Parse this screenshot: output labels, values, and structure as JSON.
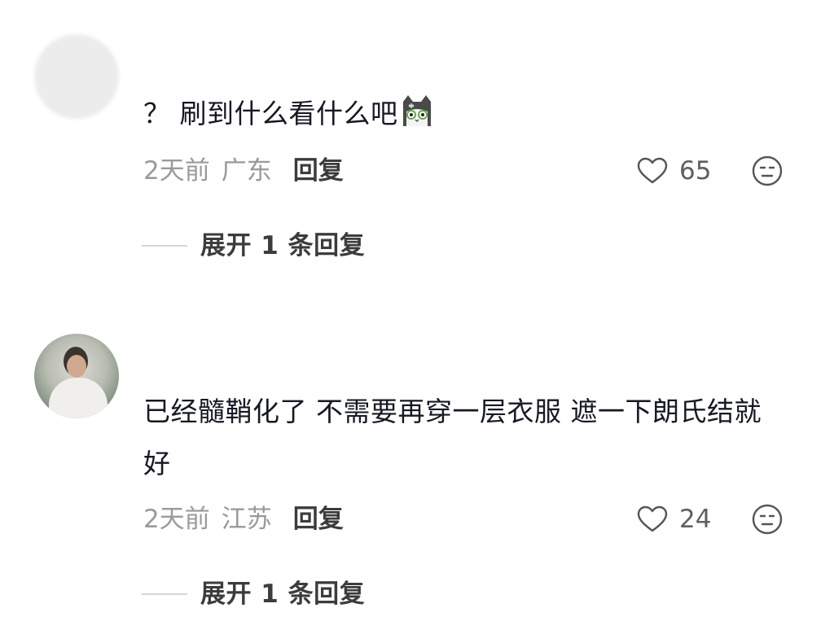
{
  "comments": [
    {
      "text": "？ 刷到什么看什么吧",
      "emoji": "cat-emoji",
      "time": "2天前",
      "location": "广东",
      "reply_label": "回复",
      "likes": "65",
      "expand_label": "展开 1 条回复"
    },
    {
      "text": "已经髓鞘化了 不需要再穿一层衣服 遮一下朗氏结就好",
      "time": "2天前",
      "location": "江苏",
      "reply_label": "回复",
      "likes": "24",
      "expand_label": "展开 1 条回复"
    }
  ],
  "colors": {
    "text_primary": "#161823",
    "text_meta": "#9a9a9a",
    "text_action": "#3c3c3c",
    "divider": "#d5d5d5"
  }
}
